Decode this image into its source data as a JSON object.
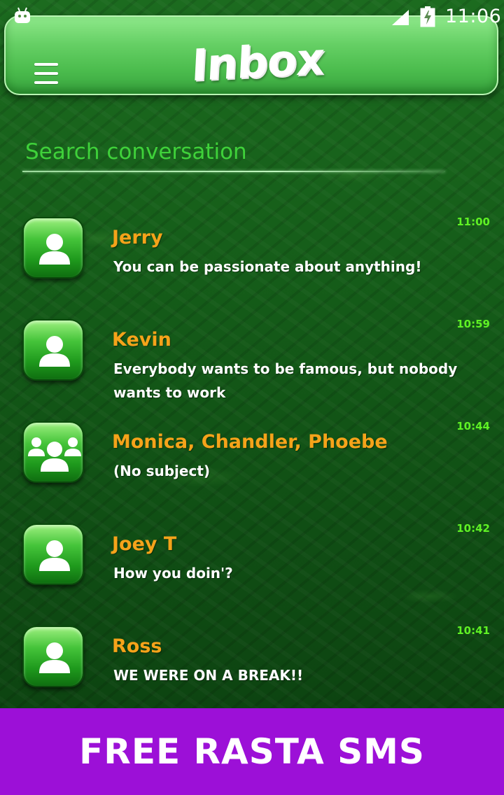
{
  "status_bar": {
    "time": "11:06",
    "icons": [
      "android-icon",
      "signal-icon",
      "battery-icon"
    ]
  },
  "header": {
    "title": "Inbox",
    "menu_icon": "hamburger-menu-icon"
  },
  "search": {
    "placeholder": "Search conversation",
    "value": ""
  },
  "conversations": [
    {
      "name": "Jerry",
      "preview": " You can be passionate about anything!",
      "time": "11:00",
      "avatar": "contact-avatar-icon"
    },
    {
      "name": "Kevin",
      "preview": " Everybody wants to be famous, but nobody wants to work",
      "time": "10:59",
      "avatar": "contact-avatar-icon"
    },
    {
      "name": "Monica, Chandler, Phoebe",
      "preview": "(No subject)",
      "time": "10:44",
      "avatar": "group-avatar-icon"
    },
    {
      "name": "Joey T",
      "preview": "How you doin'?",
      "time": "10:42",
      "avatar": "contact-avatar-icon"
    },
    {
      "name": "Ross",
      "preview": "WE WERE ON A BREAK!!",
      "time": "10:41",
      "avatar": "contact-avatar-icon"
    }
  ],
  "banner": {
    "text": "FREE RASTA SMS",
    "background": "#9c10d7"
  },
  "colors": {
    "name": "#f5a31a",
    "time": "#5ff224",
    "search": "#3fd13a",
    "header": "#5fcb5f"
  }
}
